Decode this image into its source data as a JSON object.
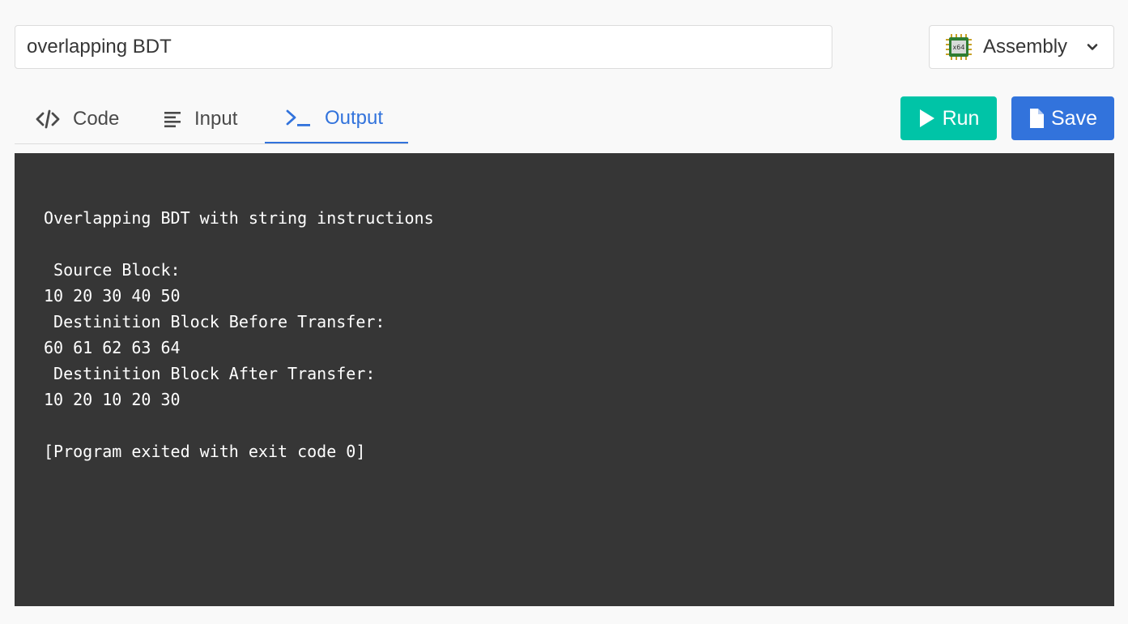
{
  "header": {
    "title_value": "overlapping BDT",
    "language": {
      "label": "Assembly",
      "icon": "x64-chip-icon",
      "icon_text": "x64"
    }
  },
  "tabs": [
    {
      "label": "Code",
      "icon": "code-icon",
      "active": false
    },
    {
      "label": "Input",
      "icon": "align-left-icon",
      "active": false
    },
    {
      "label": "Output",
      "icon": "terminal-icon",
      "active": true
    }
  ],
  "toolbar": {
    "run_label": "Run",
    "save_label": "Save"
  },
  "output": {
    "lines": [
      "Overlapping BDT with string instructions",
      "",
      " Source Block:",
      "10 20 30 40 50",
      " Destinition Block Before Transfer:",
      "60 61 62 63 64",
      " Destinition Block After Transfer:",
      "10 20 10 20 30",
      "",
      "[Program exited with exit code 0]"
    ]
  },
  "colors": {
    "accent": "#3273dc",
    "run": "#00c4a7",
    "console_bg": "#363636"
  }
}
